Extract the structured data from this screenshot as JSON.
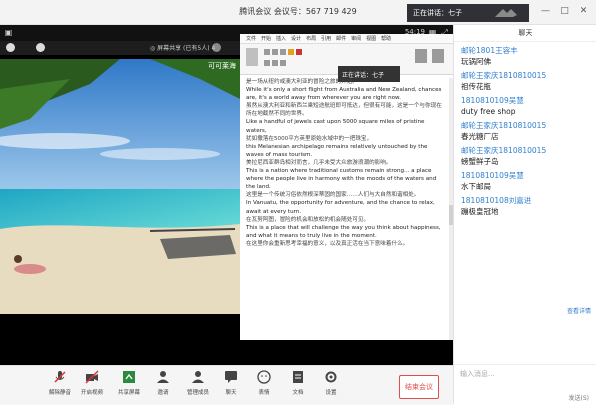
{
  "window": {
    "title": "腾讯会议 会议号：567 719 429",
    "speaking": "正在讲话：七子",
    "controls": [
      "—",
      "□",
      "✕"
    ]
  },
  "video": {
    "timer": "54:19",
    "beach_label": "可可莱海",
    "thumb_label": "◎ 屏幕共享 (已有5人) 4"
  },
  "document": {
    "tabs": [
      "文件",
      "开始",
      "插入",
      "设计",
      "布局",
      "引用",
      "邮件",
      "审阅",
      "视图",
      "帮助"
    ],
    "tooltip": "正在讲话：七子",
    "paragraphs": [
      {
        "text": "是一场从纽约或澳大利亚的冒险之旅的开始。",
        "zh": true
      },
      {
        "text": "While it's only a short flight from Australia and New Zealand, chances are, it's a world away from wherever you are right now.",
        "zh": false
      },
      {
        "text": "虽然从澳大利亚和新西兰乘短途航班即可抵达，但很有可能，这是一个与你现在所在地截然不同的世界。",
        "zh": true
      },
      {
        "text": "Like a handful of jewels cast upon 5000 square miles of pristine waters,",
        "zh": false
      },
      {
        "text": "犹如撒落在5000平方英里原始水域中的一把珠宝，",
        "zh": true
      },
      {
        "text": "this Melanesian archipelago remains relatively untouched by the waves of mass tourism.",
        "zh": false
      },
      {
        "text": "美拉尼西亚群岛相对而言，几乎未受大众旅游浪潮的影响。",
        "zh": true
      },
      {
        "text": "This is a nation where traditional customs remain strong... a place where the people live in harmony with the moods of the waters and the land.",
        "zh": false
      },
      {
        "text": "这里是一个传统习俗依然根深蒂固的国家……人们与大自然和谐相处。",
        "zh": true
      },
      {
        "text": "In Vanuatu, the opportunity for adventure, and the chance to relax, await at every turn.",
        "zh": false
      },
      {
        "text": "在瓦努阿图，冒险的机会和放松的机会随处可见。",
        "zh": true
      },
      {
        "text": "This is a place that will challenge the way you think about happiness, and what it means to truly live in the moment.",
        "zh": false
      },
      {
        "text": "在这里你会重新思考幸福的意义，以及真正活在当下意味着什么。",
        "zh": true
      }
    ]
  },
  "toolbar": {
    "items": [
      {
        "label": "解除静音",
        "icon": "mic-muted-icon"
      },
      {
        "label": "开启视频",
        "icon": "camera-off-icon"
      },
      {
        "label": "共享屏幕",
        "icon": "share-screen-icon"
      },
      {
        "label": "邀请",
        "icon": "invite-icon"
      },
      {
        "label": "管理成员",
        "icon": "members-icon"
      },
      {
        "label": "聊天",
        "icon": "chat-icon"
      },
      {
        "label": "表情",
        "icon": "emoji-icon"
      },
      {
        "label": "文档",
        "icon": "document-icon"
      },
      {
        "label": "设置",
        "icon": "settings-icon"
      }
    ],
    "end_label": "结束会议"
  },
  "chat": {
    "title": "聊天",
    "messages": [
      {
        "sender": "邮轮1801王容丰",
        "text": "玩锅阿佛"
      },
      {
        "sender": "邮轮王家庆1810810015",
        "text": "祖传花瓶"
      },
      {
        "sender": "1810810109吴慧",
        "text": "duty free shop"
      },
      {
        "sender": "邮轮王家庆1810810015",
        "text": "春光糖厂店"
      },
      {
        "sender": "邮轮王家庆1810810015",
        "text": "螃蟹鲜子岛"
      },
      {
        "sender": "1810810109吴慧",
        "text": "水下邮局"
      },
      {
        "sender": "1810810108刘嘉进",
        "text": "蹦极皇冠地"
      }
    ],
    "more": "查看详情",
    "placeholder": "输入消息...",
    "send": "发送(S)"
  }
}
